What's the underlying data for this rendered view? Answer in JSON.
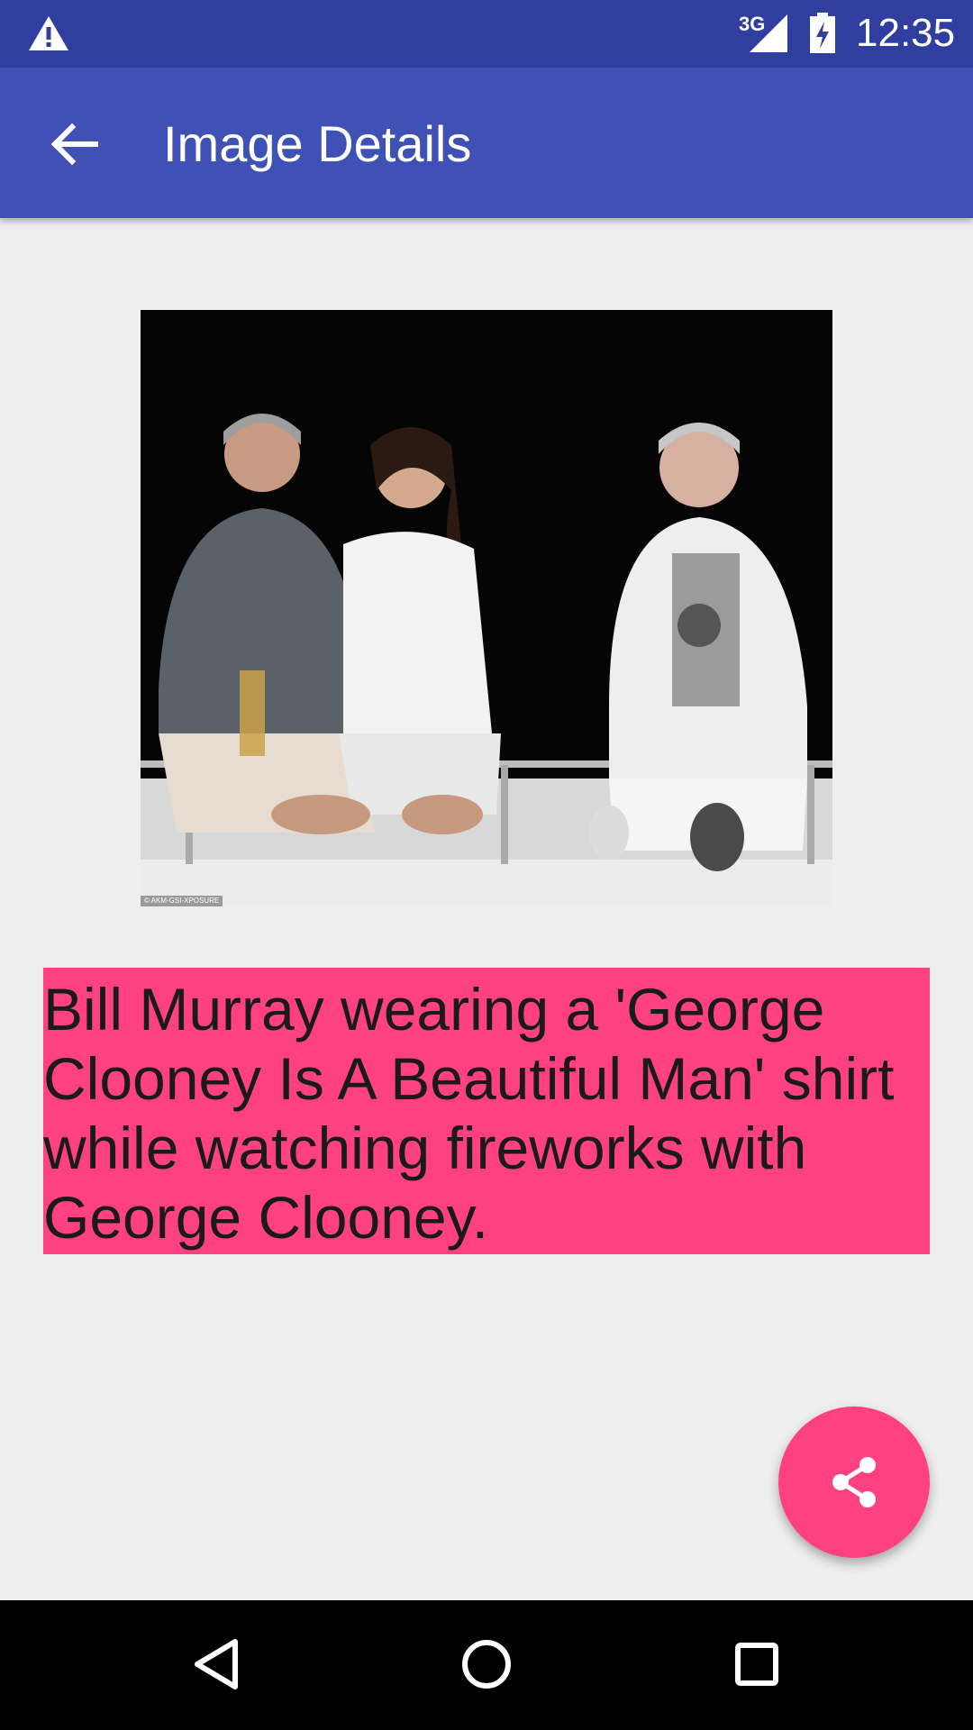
{
  "status_bar": {
    "time": "12:35",
    "network": "3G",
    "icons": [
      "warning-icon",
      "signal-icon",
      "battery-charging-icon"
    ]
  },
  "app_bar": {
    "title": "Image Details",
    "back_icon": "arrow-back-icon"
  },
  "photo": {
    "credit": "© AKM-GSI-XPOSURE"
  },
  "caption": {
    "text": "Bill Murray wearing a 'George Clooney Is A Beautiful Man' shirt while watching fireworks with George Clooney."
  },
  "fab": {
    "icon": "share-icon"
  },
  "nav_bar": {
    "icons": [
      "back-triangle-icon",
      "home-circle-icon",
      "recents-square-icon"
    ]
  },
  "colors": {
    "status_bar": "#303F9F",
    "app_bar": "#3F51B5",
    "accent": "#FF4081",
    "background": "#EEEEEE"
  }
}
